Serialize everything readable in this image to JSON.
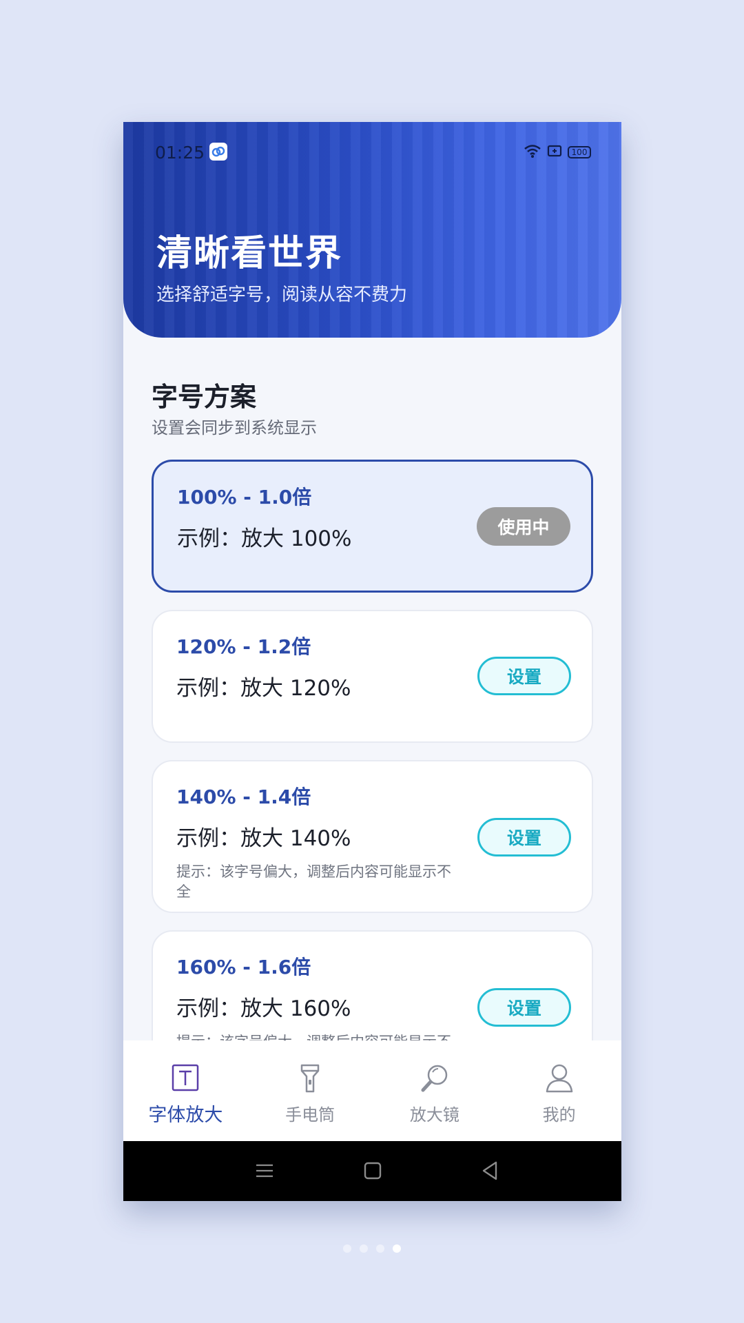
{
  "status_bar": {
    "time": "01:25",
    "battery": "100"
  },
  "header": {
    "title": "清晰看世界",
    "subtitle": "选择舒适字号，阅读从容不费力"
  },
  "section": {
    "title": "字号方案",
    "subtitle": "设置会同步到系统显示"
  },
  "options": [
    {
      "title": "100% - 1.0倍",
      "example": "示例：放大 100%",
      "button": "使用中",
      "active": true,
      "tip": ""
    },
    {
      "title": "120% - 1.2倍",
      "example": "示例：放大 120%",
      "button": "设置",
      "active": false,
      "tip": ""
    },
    {
      "title": "140% - 1.4倍",
      "example": "示例：放大 140%",
      "button": "设置",
      "active": false,
      "tip": "提示：该字号偏大，调整后内容可能显示不全"
    },
    {
      "title": "160% - 1.6倍",
      "example": "示例：放大 160%",
      "button": "设置",
      "active": false,
      "tip": "提示：该字号偏大，调整后内容可能显示不全"
    }
  ],
  "tabs": [
    {
      "label": "字体放大",
      "icon": "text-size-icon",
      "active": true
    },
    {
      "label": "手电筒",
      "icon": "flashlight-icon",
      "active": false
    },
    {
      "label": "放大镜",
      "icon": "magnifier-icon",
      "active": false
    },
    {
      "label": "我的",
      "icon": "profile-icon",
      "active": false
    }
  ],
  "colors": {
    "accent": "#2c4ba9",
    "set_button": "#23bdd3",
    "header_start": "#1d3aa3",
    "header_end": "#4f73ea"
  },
  "pager": {
    "count": 4,
    "current": 4
  }
}
